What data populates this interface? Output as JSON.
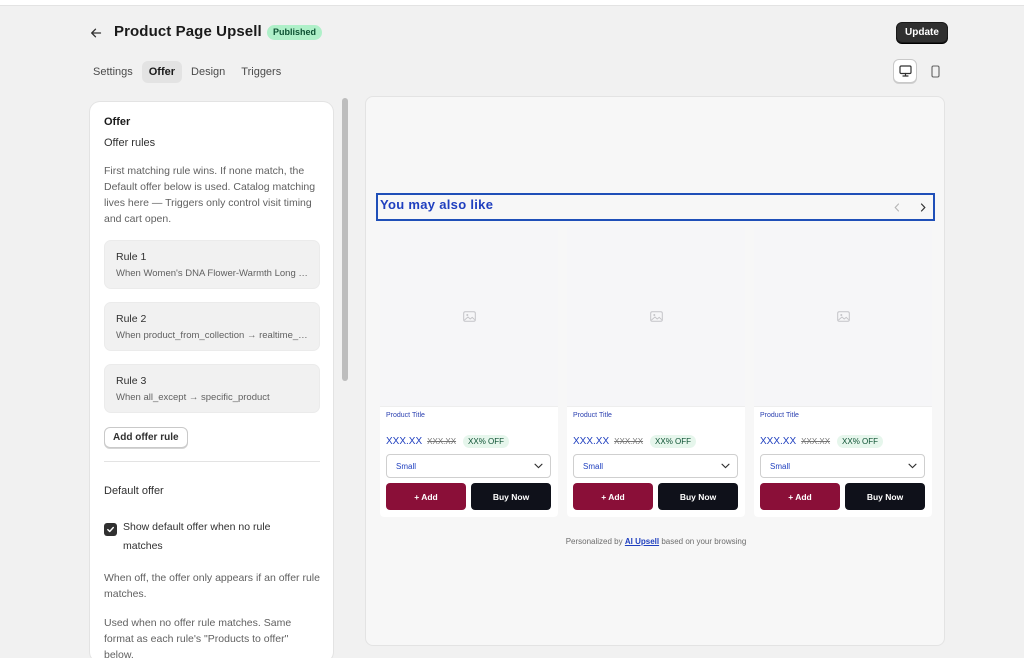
{
  "header": {
    "title": "Product Page Upsell",
    "status": "Published",
    "update_label": "Update"
  },
  "tabs": [
    {
      "label": "Settings",
      "active": false
    },
    {
      "label": "Offer",
      "active": true
    },
    {
      "label": "Design",
      "active": false
    },
    {
      "label": "Triggers",
      "active": false
    }
  ],
  "device_toggle": {
    "desktop_icon": "desktop-icon",
    "mobile_icon": "mobile-icon",
    "selected": "desktop"
  },
  "offer_panel": {
    "section_title": "Offer",
    "rules_title": "Offer rules",
    "help_text": "First matching rule wins. If none match, the Default offer below is used. Catalog matching lives here — Triggers only control visit timing and cart open.",
    "rules": [
      {
        "title": "Rule 1",
        "description": "When Women's DNA Flower-Warmth Long Sleeve → specific_product"
      },
      {
        "title": "Rule 2",
        "description": "When product_from_collection → realtime_recommendations"
      },
      {
        "title": "Rule 3",
        "description": "When all_except → specific_product"
      }
    ],
    "add_rule_label": "Add offer rule",
    "default_offer_title": "Default offer",
    "show_default_label": "Show default offer when no rule matches",
    "show_default_checked": true,
    "when_off_text": "When off, the offer only appears if an offer rule matches.",
    "used_when_text": "Used when no offer rule matches. Same format as each rule's \"Products to offer\" below."
  },
  "preview": {
    "widget_title": "You may also like",
    "products": [
      {
        "title": "Product Title",
        "price": "XXX.XX",
        "compare_price": "XXX.XX",
        "discount": "XX% OFF",
        "variant": "Small",
        "add_label": "+ Add",
        "buy_label": "Buy Now"
      },
      {
        "title": "Product Title",
        "price": "XXX.XX",
        "compare_price": "XXX.XX",
        "discount": "XX% OFF",
        "variant": "Small",
        "add_label": "+ Add",
        "buy_label": "Buy Now"
      },
      {
        "title": "Product Title",
        "price": "XXX.XX",
        "compare_price": "XXX.XX",
        "discount": "XX% OFF",
        "variant": "Small",
        "add_label": "+ Add",
        "buy_label": "Buy Now"
      }
    ],
    "footer_prefix": "Personalized by",
    "footer_link": "AI Upsell",
    "footer_suffix": "based on your browsing"
  },
  "colors": {
    "accent_blue": "#1f3fbf",
    "add_button": "#8a0f38",
    "buy_button": "#0f111a",
    "badge_bg": "#aff0c9"
  }
}
